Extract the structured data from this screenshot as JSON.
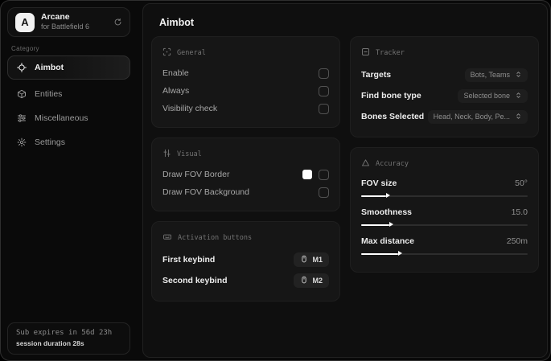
{
  "sidebar": {
    "logo_letter": "A",
    "app_name": "Arcane",
    "app_subtitle": "for Battlefield 6",
    "category_label": "Category",
    "nav": [
      {
        "label": "Aimbot",
        "active": true
      },
      {
        "label": "Entities",
        "active": false
      },
      {
        "label": "Miscellaneous",
        "active": false
      },
      {
        "label": "Settings",
        "active": false
      }
    ],
    "subscription": {
      "expires": "Sub expires in 56d 23h",
      "session": "session duration 28s"
    }
  },
  "main": {
    "title": "Aimbot",
    "cards": {
      "general": {
        "title": "General",
        "rows": [
          {
            "label": "Enable",
            "checked": false
          },
          {
            "label": "Always",
            "checked": false
          },
          {
            "label": "Visibility check",
            "checked": false
          }
        ]
      },
      "visual": {
        "title": "Visual",
        "rows": [
          {
            "label": "Draw FOV Border",
            "swatch_color": "#ffffff",
            "checked": false
          },
          {
            "label": "Draw FOV Background",
            "checked": false
          }
        ]
      },
      "activation": {
        "title": "Activation buttons",
        "rows": [
          {
            "label": "First keybind",
            "key": "M1"
          },
          {
            "label": "Second keybind",
            "key": "M2"
          }
        ]
      },
      "tracker": {
        "title": "Tracker",
        "rows": [
          {
            "label": "Targets",
            "value": "Bots, Teams"
          },
          {
            "label": "Find bone type",
            "value": "Selected bone"
          },
          {
            "label": "Bones Selected",
            "value": "Head, Neck, Body, Pe..."
          }
        ]
      },
      "accuracy": {
        "title": "Accuracy",
        "rows": [
          {
            "label": "FOV size",
            "value": "50°",
            "percent": 15
          },
          {
            "label": "Smoothness",
            "value": "15.0",
            "percent": 17
          },
          {
            "label": "Max distance",
            "value": "250m",
            "percent": 22
          }
        ]
      }
    }
  },
  "colors": {
    "swatch_white": "#ffffff",
    "card_bg": "#161616",
    "panel_bg": "#0f0f0f"
  }
}
